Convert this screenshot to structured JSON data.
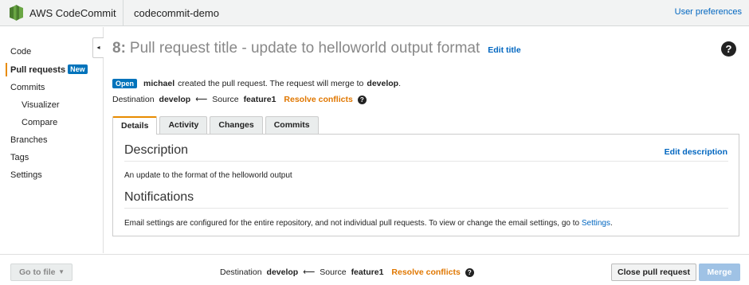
{
  "header": {
    "brand": "AWS CodeCommit",
    "repository": "codecommit-demo",
    "user_preferences": "User preferences"
  },
  "sidebar": {
    "items": [
      {
        "label": "Code"
      },
      {
        "label": "Pull requests",
        "badge": "New"
      },
      {
        "label": "Commits"
      },
      {
        "label": "Visualizer"
      },
      {
        "label": "Compare"
      },
      {
        "label": "Branches"
      },
      {
        "label": "Tags"
      },
      {
        "label": "Settings"
      }
    ],
    "collapse_icon": "◂"
  },
  "pull_request": {
    "number": "8:",
    "title": "Pull request title - update to helloworld output format",
    "edit_title": "Edit title",
    "help_icon": "?",
    "status": "Open",
    "author": "michael",
    "status_text": "created the pull request. The request will merge to",
    "target_branch": "develop",
    "period": ".",
    "destination_label": "Destination",
    "destination": "develop",
    "arrow": "⟵",
    "source_label": "Source",
    "source": "feature1",
    "resolve_conflicts": "Resolve conflicts"
  },
  "tabs": [
    {
      "label": "Details"
    },
    {
      "label": "Activity"
    },
    {
      "label": "Changes"
    },
    {
      "label": "Commits"
    }
  ],
  "details": {
    "description_heading": "Description",
    "edit_description": "Edit description",
    "description_text": "An update to the format of the helloworld output",
    "notifications_heading": "Notifications",
    "notifications_text": "Email settings are configured for the entire repository, and not individual pull requests. To view or change the email settings, go to",
    "settings_link": "Settings",
    "period": "."
  },
  "footer": {
    "go_to_file": "Go to file",
    "caret": "▼",
    "destination_label": "Destination",
    "destination": "develop",
    "arrow": "⟵",
    "source_label": "Source",
    "source": "feature1",
    "resolve_conflicts": "Resolve conflicts",
    "close_pull_request": "Close pull request",
    "merge": "Merge"
  },
  "colors": {
    "accent_orange": "#e88b00",
    "link_blue": "#0066c0",
    "badge_blue": "#0073bb",
    "merge_disabled": "#9fc2e5"
  }
}
